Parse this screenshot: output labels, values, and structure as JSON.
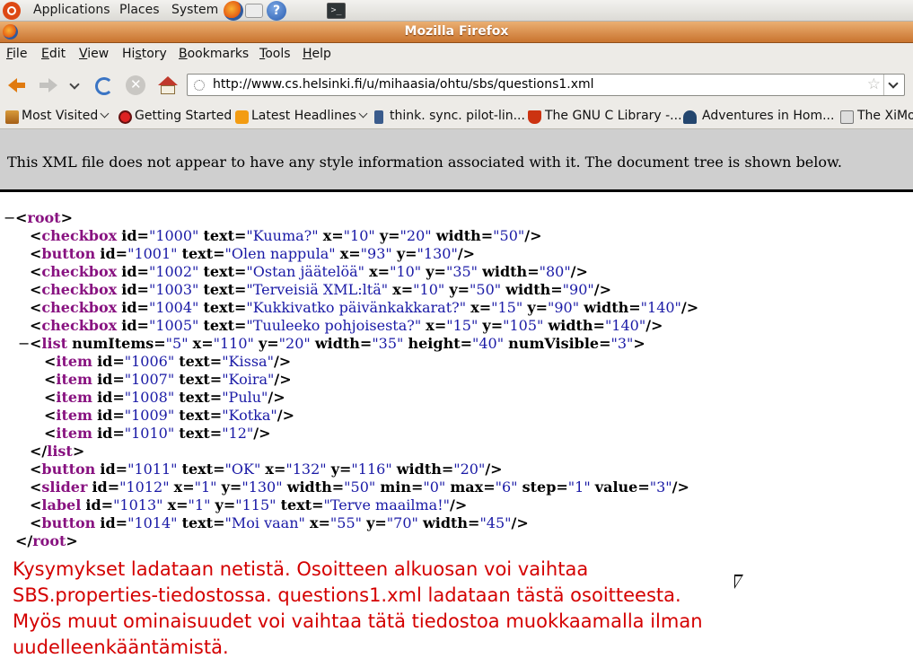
{
  "panel": {
    "applications": "Applications",
    "places": "Places",
    "system": "System"
  },
  "window": {
    "title": "Mozilla Firefox"
  },
  "menubar": {
    "items": [
      {
        "label": "File",
        "ul": "F",
        "rest": "ile"
      },
      {
        "label": "Edit",
        "ul": "E",
        "rest": "dit"
      },
      {
        "label": "View",
        "ul": "V",
        "rest": "iew"
      },
      {
        "label": "History",
        "pre": "Hi",
        "ul": "s",
        "rest": "tory"
      },
      {
        "label": "Bookmarks",
        "ul": "B",
        "rest": "ookmarks"
      },
      {
        "label": "Tools",
        "ul": "T",
        "rest": "ools"
      },
      {
        "label": "Help",
        "ul": "H",
        "rest": "elp"
      }
    ]
  },
  "navbar": {
    "url": "http://www.cs.helsinki.fi/u/mihaasia/ohtu/sbs/questions1.xml"
  },
  "bookmarks": [
    "Most Visited",
    "Getting Started",
    "Latest Headlines",
    "think. sync. pilot-lin...",
    "The GNU C Library -...",
    "Adventures in Hom...",
    "The XiMo"
  ],
  "xml_info": "This XML file does not appear to have any style information associated with it. The document tree is shown below.",
  "xml": {
    "root": "root",
    "list": {
      "tag": "list",
      "attrs": [
        [
          "numItems",
          "5"
        ],
        [
          "x",
          "110"
        ],
        [
          "y",
          "20"
        ],
        [
          "width",
          "35"
        ],
        [
          "height",
          "40"
        ],
        [
          "numVisible",
          "3"
        ]
      ]
    },
    "before_list": [
      {
        "tag": "checkbox",
        "attrs": [
          [
            "id",
            "1000"
          ],
          [
            "text",
            "Kuuma?"
          ],
          [
            "x",
            "10"
          ],
          [
            "y",
            "20"
          ],
          [
            "width",
            "50"
          ]
        ]
      },
      {
        "tag": "button",
        "attrs": [
          [
            "id",
            "1001"
          ],
          [
            "text",
            "Olen nappula"
          ],
          [
            "x",
            "93"
          ],
          [
            "y",
            "130"
          ]
        ]
      },
      {
        "tag": "checkbox",
        "attrs": [
          [
            "id",
            "1002"
          ],
          [
            "text",
            "Ostan jäätelöä"
          ],
          [
            "x",
            "10"
          ],
          [
            "y",
            "35"
          ],
          [
            "width",
            "80"
          ]
        ]
      },
      {
        "tag": "checkbox",
        "attrs": [
          [
            "id",
            "1003"
          ],
          [
            "text",
            "Terveisiä XML:ltä"
          ],
          [
            "x",
            "10"
          ],
          [
            "y",
            "50"
          ],
          [
            "width",
            "90"
          ]
        ]
      },
      {
        "tag": "checkbox",
        "attrs": [
          [
            "id",
            "1004"
          ],
          [
            "text",
            "Kukkivatko päivänkakkarat?"
          ],
          [
            "x",
            "15"
          ],
          [
            "y",
            "90"
          ],
          [
            "width",
            "140"
          ]
        ]
      },
      {
        "tag": "checkbox",
        "attrs": [
          [
            "id",
            "1005"
          ],
          [
            "text",
            "Tuuleeko pohjoisesta?"
          ],
          [
            "x",
            "15"
          ],
          [
            "y",
            "105"
          ],
          [
            "width",
            "140"
          ]
        ]
      }
    ],
    "items": [
      {
        "tag": "item",
        "attrs": [
          [
            "id",
            "1006"
          ],
          [
            "text",
            "Kissa"
          ]
        ]
      },
      {
        "tag": "item",
        "attrs": [
          [
            "id",
            "1007"
          ],
          [
            "text",
            "Koira"
          ]
        ]
      },
      {
        "tag": "item",
        "attrs": [
          [
            "id",
            "1008"
          ],
          [
            "text",
            "Pulu"
          ]
        ]
      },
      {
        "tag": "item",
        "attrs": [
          [
            "id",
            "1009"
          ],
          [
            "text",
            "Kotka"
          ]
        ]
      },
      {
        "tag": "item",
        "attrs": [
          [
            "id",
            "1010"
          ],
          [
            "text",
            "12"
          ]
        ]
      }
    ],
    "after_list": [
      {
        "tag": "button",
        "attrs": [
          [
            "id",
            "1011"
          ],
          [
            "text",
            "OK"
          ],
          [
            "x",
            "132"
          ],
          [
            "y",
            "116"
          ],
          [
            "width",
            "20"
          ]
        ]
      },
      {
        "tag": "slider",
        "attrs": [
          [
            "id",
            "1012"
          ],
          [
            "x",
            "1"
          ],
          [
            "y",
            "130"
          ],
          [
            "width",
            "50"
          ],
          [
            "min",
            "0"
          ],
          [
            "max",
            "6"
          ],
          [
            "step",
            "1"
          ],
          [
            "value",
            "3"
          ]
        ]
      },
      {
        "tag": "label",
        "attrs": [
          [
            "id",
            "1013"
          ],
          [
            "x",
            "1"
          ],
          [
            "y",
            "115"
          ],
          [
            "text",
            "Terve maailma!"
          ]
        ]
      },
      {
        "tag": "button",
        "attrs": [
          [
            "id",
            "1014"
          ],
          [
            "text",
            "Moi vaan"
          ],
          [
            "x",
            "55"
          ],
          [
            "y",
            "70"
          ],
          [
            "width",
            "45"
          ]
        ]
      }
    ]
  },
  "note_lines": [
    "Kysymykset ladataan netistä. Osoitteen alkuosan voi vaihtaa",
    "SBS.properties-tiedostossa. questions1.xml ladataan tästä osoitteesta.",
    "Myös muut ominaisuudet voi vaihtaa tätä tiedostoa muokkaamalla ilman",
    "uudelleenkääntämistä."
  ]
}
